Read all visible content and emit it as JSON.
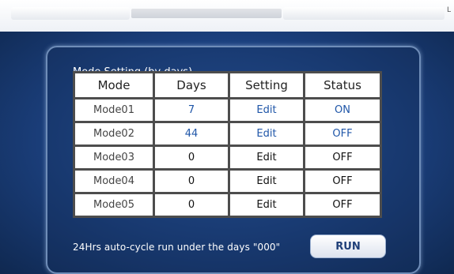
{
  "panel": {
    "title": "Mode Setting (by days)"
  },
  "table": {
    "headers": [
      "Mode",
      "Days",
      "Setting",
      "Status"
    ],
    "rows": [
      {
        "mode": "Mode01",
        "days": "7",
        "setting": "Edit",
        "status": "ON"
      },
      {
        "mode": "Mode02",
        "days": "44",
        "setting": "Edit",
        "status": "OFF"
      },
      {
        "mode": "Mode03",
        "days": "0",
        "setting": "Edit",
        "status": "OFF"
      },
      {
        "mode": "Mode04",
        "days": "0",
        "setting": "Edit",
        "status": "OFF"
      },
      {
        "mode": "Mode05",
        "days": "0",
        "setting": "Edit",
        "status": "OFF"
      }
    ]
  },
  "footer": {
    "note": "24Hrs auto-cycle run under the days \"000\"",
    "run_label": "RUN"
  },
  "colors": {
    "highlight_text": "#1f56a8",
    "background": "#1d3a6e"
  },
  "topbar": {
    "corner_mark": "L"
  }
}
